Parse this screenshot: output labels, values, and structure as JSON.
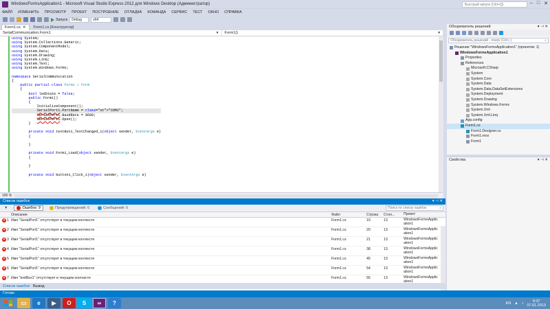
{
  "window": {
    "title": "WindowsFormsApplication1 - Microsoft Visual Studio Express 2012 для Windows Desktop (Администратор)",
    "quick_launch": "Быстрый запуск (Ctrl+Q)"
  },
  "menu": [
    "ФАЙЛ",
    "ИЗМЕНИТЬ",
    "ПРОСМОТР",
    "ПРОЕКТ",
    "ПОСТРОЕНИЕ",
    "ОТЛАДКА",
    "КОМАНДА",
    "СЕРВИС",
    "ТЕСТ",
    "ОКНО",
    "СПРАВКА"
  ],
  "toolbar": {
    "run_label": "Запуск",
    "config": "Debug",
    "platform": "x64"
  },
  "tabs": [
    {
      "label": "Form1.cs",
      "active": true
    },
    {
      "label": "Form1.cs [Конструктор]",
      "active": false
    }
  ],
  "nav": {
    "left": "SerialCommunication.Form1",
    "right": "Form1()"
  },
  "code": {
    "lines": [
      "using System;",
      "using System.Collections.Generic;",
      "using System.ComponentModel;",
      "using System.Data;",
      "using System.Drawing;",
      "using System.Linq;",
      "using System.Text;",
      "using System.Windows.Forms;",
      "",
      "namespace SerialCommunication",
      "{",
      "    public partial class Form1 : Form",
      "    {",
      "        bool ledState = false;",
      "        public Form1()",
      "        {",
      "            InitializeComponent();",
      "            SerialPort1.PortName = \"COM2\";",
      "            SerialPort1.BaudRate = 9600;",
      "            SerialPort1.Open();",
      "        }",
      "",
      "        private void textBox1_TextChanged_1(object sender, EventArgs e)",
      "        {",
      "",
      "        }",
      "",
      "        private void Form1_Load(object sender, EventArgs e)",
      "        {",
      "",
      "        }",
      "",
      "        private void button1_Click_1(object sender, EventArgs e)"
    ]
  },
  "zoom": "100 %",
  "errors": {
    "panel_title": "Список ошибок",
    "filters": {
      "errors": "Ошибок: 9",
      "warnings": "Предупреждений: 0",
      "messages": "Сообщений: 0"
    },
    "search_placeholder": "Поиск по списку ошибок",
    "columns": {
      "desc": "Описание",
      "file": "Файл",
      "line": "Строка",
      "col": "Стол...",
      "project": "Проект"
    },
    "rows": [
      {
        "n": "1",
        "desc": "Имя \"SerialPort1\" отсутствует в текущем контексте",
        "file": "Form1.cs",
        "line": "19",
        "col": "13",
        "project": "WindowsFormsApplic ation1"
      },
      {
        "n": "2",
        "desc": "Имя \"SerialPort1\" отсутствует в текущем контексте",
        "file": "Form1.cs",
        "line": "20",
        "col": "13",
        "project": "WindowsFormsApplic ation1"
      },
      {
        "n": "3",
        "desc": "Имя \"SerialPort1\" отсутствует в текущем контексте",
        "file": "Form1.cs",
        "line": "21",
        "col": "13",
        "project": "WindowsFormsApplic ation1"
      },
      {
        "n": "4",
        "desc": "Имя \"SerialPort1\" отсутствует в текущем контексте",
        "file": "Form1.cs",
        "line": "38",
        "col": "13",
        "project": "WindowsFormsApplic ation1"
      },
      {
        "n": "5",
        "desc": "Имя \"SerialPort1\" отсутствует в текущем контексте",
        "file": "Form1.cs",
        "line": "45",
        "col": "13",
        "project": "WindowsFormsApplic ation1"
      },
      {
        "n": "6",
        "desc": "Имя \"SerialPort1\" отсутствует в текущем контексте",
        "file": "Form1.cs",
        "line": "54",
        "col": "13",
        "project": "WindowsFormsApplic ation1"
      },
      {
        "n": "7",
        "desc": "Имя \"textBox1\" отсутствует в текущем контексте",
        "file": "Form1.cs",
        "line": "55",
        "col": "13",
        "project": "WindowsFormsApplic ation1"
      }
    ],
    "bottom_tabs": [
      "Список ошибок",
      "Вывод"
    ]
  },
  "solution_explorer": {
    "title": "Обозреватель решений",
    "search_placeholder": "Обозреватель решений - поиск (Ctrl+;)",
    "tree": [
      {
        "label": "Решение \"WindowsFormsApplication1\" (проектов: 1)",
        "indent": 0
      },
      {
        "label": "WindowsFormsApplication1",
        "indent": 1,
        "bold": true
      },
      {
        "label": "Properties",
        "indent": 2
      },
      {
        "label": "References",
        "indent": 2
      },
      {
        "label": "Microsoft.CSharp",
        "indent": 3
      },
      {
        "label": "System",
        "indent": 3
      },
      {
        "label": "System.Core",
        "indent": 3
      },
      {
        "label": "System.Data",
        "indent": 3
      },
      {
        "label": "System.Data.DataSetExtensions",
        "indent": 3
      },
      {
        "label": "System.Deployment",
        "indent": 3
      },
      {
        "label": "System.Drawing",
        "indent": 3
      },
      {
        "label": "System.Windows.Forms",
        "indent": 3
      },
      {
        "label": "System.Xml",
        "indent": 3
      },
      {
        "label": "System.Xml.Linq",
        "indent": 3
      },
      {
        "label": "App.config",
        "indent": 2
      },
      {
        "label": "Form1.cs",
        "indent": 2,
        "selected": true
      },
      {
        "label": "Form1.Designer.cs",
        "indent": 3
      },
      {
        "label": "Form1.resx",
        "indent": 3
      },
      {
        "label": "Form1",
        "indent": 3
      }
    ]
  },
  "properties": {
    "title": "Свойства"
  },
  "status": "Готово",
  "taskbar": {
    "lang": "EN",
    "time": "9:37",
    "date": "07.01.2013"
  }
}
